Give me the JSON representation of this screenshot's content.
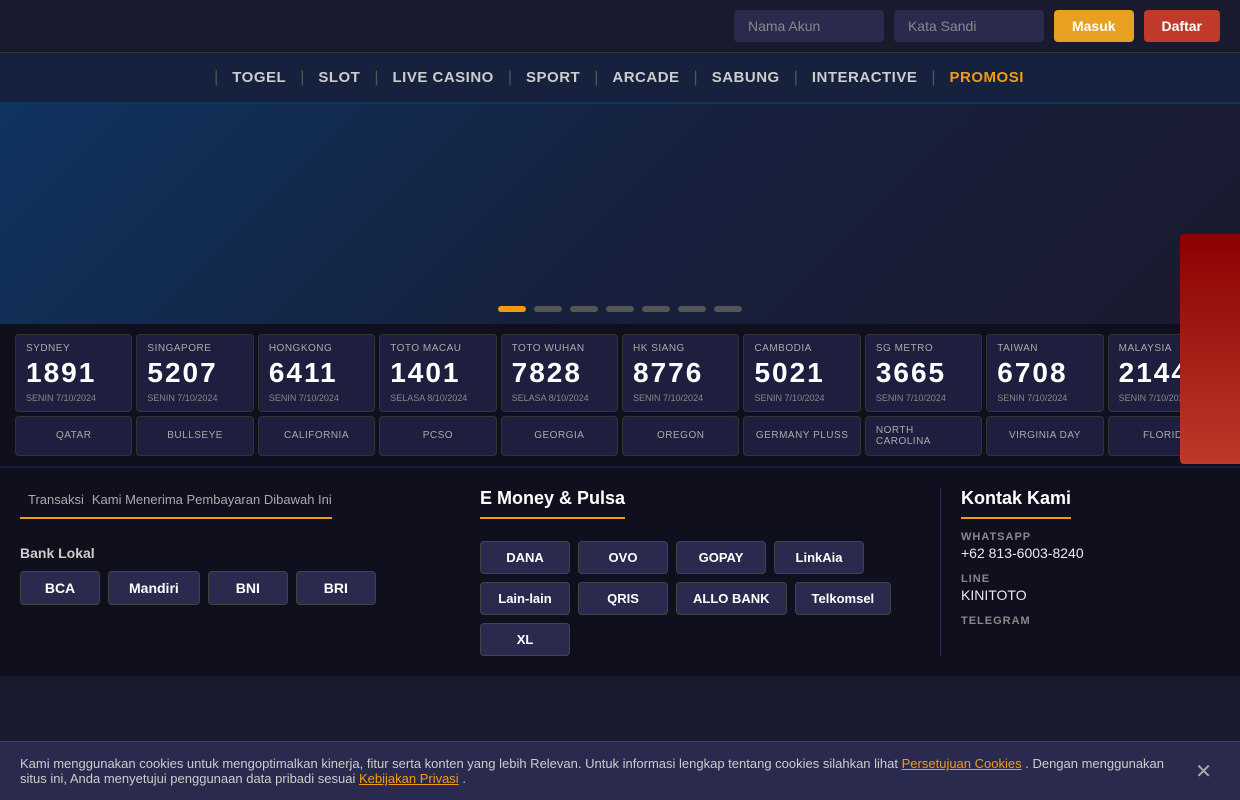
{
  "header": {
    "username_placeholder": "Nama Akun",
    "password_placeholder": "Kata Sandi",
    "login_btn": "Masuk",
    "register_btn": "Daftar"
  },
  "nav": {
    "items": [
      {
        "label": "TOGEL",
        "highlight": false
      },
      {
        "label": "SLOT",
        "highlight": false
      },
      {
        "label": "LIVE CASINO",
        "highlight": false
      },
      {
        "label": "SPORT",
        "highlight": false
      },
      {
        "label": "ARCADE",
        "highlight": false
      },
      {
        "label": "SABUNG",
        "highlight": false
      },
      {
        "label": "INTERACTIVE",
        "highlight": false
      },
      {
        "label": "PROMOSI",
        "highlight": true
      }
    ]
  },
  "lottery": {
    "row1": [
      {
        "name": "SYDNEY",
        "number": "1891",
        "date": "SENIN 7/10/2024",
        "day_type": "normal"
      },
      {
        "name": "SINGAPORE",
        "number": "5207",
        "date": "SENIN 7/10/2024",
        "day_type": "normal"
      },
      {
        "name": "HONGKONG",
        "number": "6411",
        "date": "SENIN 7/10/2024",
        "day_type": "normal"
      },
      {
        "name": "TOTO MACAU",
        "number": "1401",
        "date": "SELASA 8/10/2024",
        "day_type": "selasa"
      },
      {
        "name": "TOTO WUHAN",
        "number": "7828",
        "date": "SELASA 8/10/2024",
        "day_type": "selasa"
      },
      {
        "name": "HK SIANG",
        "number": "8776",
        "date": "SENIN 7/10/2024",
        "day_type": "normal"
      },
      {
        "name": "CAMBODIA",
        "number": "5021",
        "date": "SENIN 7/10/2024",
        "day_type": "normal"
      },
      {
        "name": "SG METRO",
        "number": "3665",
        "date": "SENIN 7/10/2024",
        "day_type": "normal"
      },
      {
        "name": "TAIWAN",
        "number": "6708",
        "date": "SENIN 7/10/2024",
        "day_type": "normal"
      },
      {
        "name": "MALAYSIA",
        "number": "2144",
        "date": "SENIN 7/10/2024",
        "day_type": "normal"
      }
    ],
    "row2": [
      {
        "name": "QATAR"
      },
      {
        "name": "BULLSEYE"
      },
      {
        "name": "CALIFORNIA"
      },
      {
        "name": "PCSO"
      },
      {
        "name": "GEORGIA"
      },
      {
        "name": "OREGON"
      },
      {
        "name": "GERMANY PLUSS"
      },
      {
        "name": "NORTH CAROLINA"
      },
      {
        "name": "VIRGINIA DAY"
      },
      {
        "name": "FLORIDA"
      }
    ]
  },
  "transaksi": {
    "title": "Transaksi",
    "subtitle": "Kami Menerima Pembayaran Dibawah Ini",
    "bank_lokal": {
      "title": "Bank Lokal",
      "banks": [
        "BCA",
        "Mandiri",
        "BNI",
        "BRI"
      ]
    },
    "emoney": {
      "title": "E Money & Pulsa",
      "items": [
        "DANA",
        "OVO",
        "GOPAY",
        "LinkAia",
        "Lain-lain",
        "QRIS",
        "ALLO BANK",
        "Telkomsel",
        "XL"
      ]
    }
  },
  "kontak": {
    "title": "Kontak Kami",
    "items": [
      {
        "label": "WHATSAPP",
        "value": "+62 813-6003-8240"
      },
      {
        "label": "LINE",
        "value": "KINITOTO"
      },
      {
        "label": "TELEGRAM",
        "value": ""
      }
    ]
  },
  "cookie": {
    "text": "Kami menggunakan cookies untuk mengoptimalkan kinerja, fitur serta konten yang lebih Relevan. Untuk informasi lengkap tentang cookies silahkan lihat",
    "link_text": "Persetujuan Cookies",
    "text2": ". Dengan menggunakan situs ini, Anda menyetujui penggunaan data pribadi sesuai",
    "link2_text": "Kebijakan Privasi",
    "text3": "."
  },
  "banner_dots": [
    {
      "active": true
    },
    {
      "active": false
    },
    {
      "active": false
    },
    {
      "active": false
    },
    {
      "active": false
    },
    {
      "active": false
    },
    {
      "active": false
    }
  ]
}
